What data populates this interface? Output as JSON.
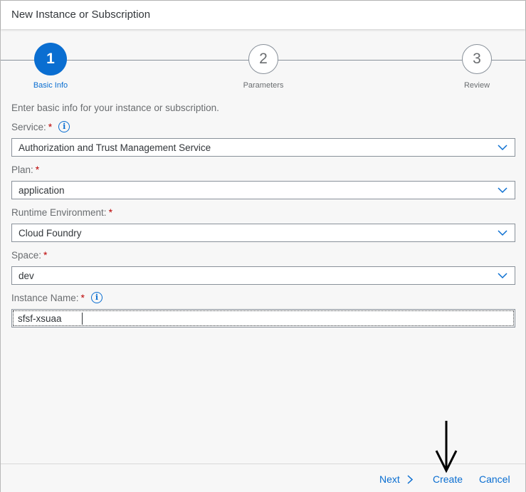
{
  "dialog": {
    "title": "New Instance or Subscription"
  },
  "wizard": {
    "steps": [
      {
        "number": "1",
        "label": "Basic Info",
        "active": true
      },
      {
        "number": "2",
        "label": "Parameters",
        "active": false
      },
      {
        "number": "3",
        "label": "Review",
        "active": false
      }
    ]
  },
  "form": {
    "intro": "Enter basic info for your instance or subscription.",
    "service": {
      "label": "Service:",
      "required_mark": "*",
      "value": "Authorization and Trust Management Service",
      "info_icon": "info-icon"
    },
    "plan": {
      "label": "Plan:",
      "required_mark": "*",
      "value": "application"
    },
    "runtime": {
      "label": "Runtime Environment:",
      "required_mark": "*",
      "value": "Cloud Foundry"
    },
    "space": {
      "label": "Space:",
      "required_mark": "*",
      "value": "dev"
    },
    "instance_name": {
      "label": "Instance Name:",
      "required_mark": "*",
      "value": "sfsf-xsuaa",
      "info_icon": "info-icon"
    }
  },
  "footer": {
    "next_label": "Next",
    "create_label": "Create",
    "cancel_label": "Cancel"
  },
  "colors": {
    "accent": "#0a6ed1",
    "required": "#bb0000",
    "text": "#32363a",
    "muted": "#6a6d70"
  }
}
